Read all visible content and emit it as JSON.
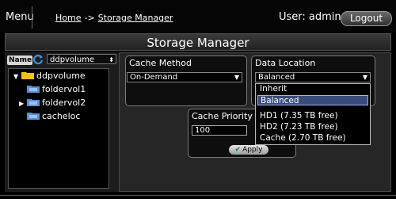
{
  "topbar": {
    "menu_label": "Menu",
    "breadcrumb": {
      "home": "Home",
      "separator": "->",
      "current": "Storage Manager"
    },
    "user_label": "User: admin",
    "logout_label": "Logout"
  },
  "page_title": "Storage Manager",
  "sidebar": {
    "name_label": "Name",
    "volume_select": "ddpvolume",
    "tree": {
      "root": "ddpvolume",
      "children": [
        "foldervol1",
        "foldervol2",
        "cacheloc"
      ]
    }
  },
  "cache_method": {
    "title": "Cache Method",
    "value": "On-Demand"
  },
  "data_location": {
    "title": "Data Location",
    "value": "Balanced",
    "options": [
      "Inherit",
      "Balanced",
      "HD1 (7.35 TB free)",
      "HD2 (7.23 TB free)",
      "Cache (2.70 TB free)"
    ],
    "selected_index": 1
  },
  "cache_priority": {
    "title": "Cache Priority",
    "value": "100"
  },
  "apply_label": "Apply",
  "colors": {
    "folder": "#f2c21b",
    "subfolder": "#5b8fd6",
    "selection": "#3a4c7a"
  }
}
